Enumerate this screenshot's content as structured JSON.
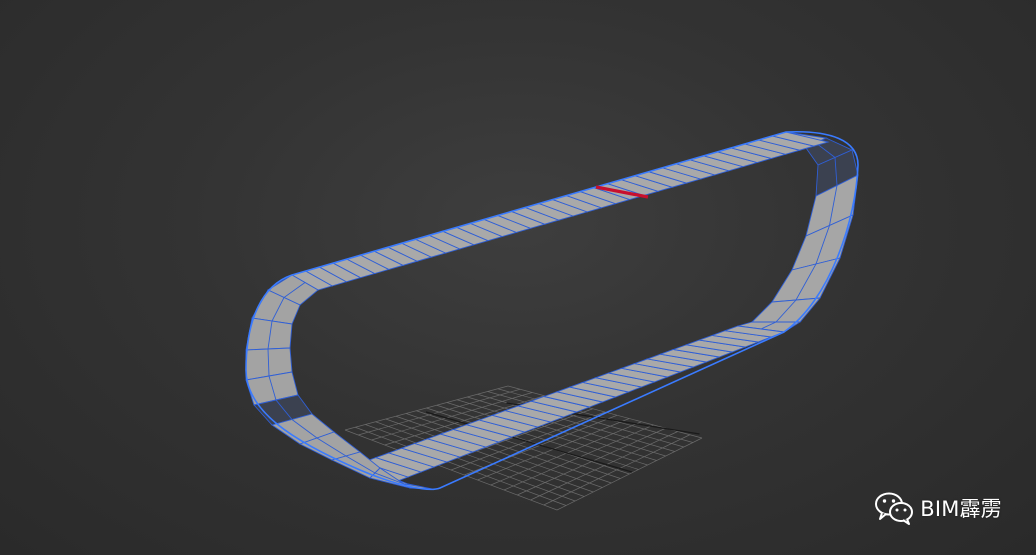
{
  "viewport": {
    "background_color": "#333333",
    "object": {
      "type": "closed-loop-strip",
      "face_color": "#a8a8a8",
      "edge_color": "#2f5fd6",
      "outline_color": "#3a7bff",
      "selected_edge_color": "#c8102e",
      "dark_band_color": "#2a2f3a"
    },
    "grid": {
      "line_color": "#6a6a6a",
      "axis_color": "#1a1a1a"
    }
  },
  "watermark": {
    "icon": "wechat-icon",
    "text": "BIM霹雳"
  }
}
